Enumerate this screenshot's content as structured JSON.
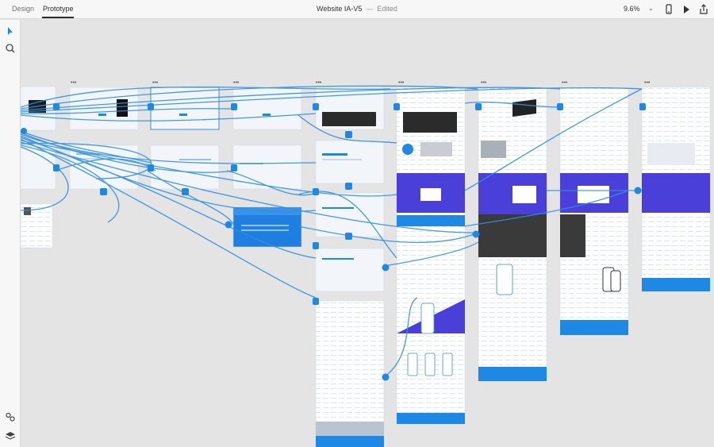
{
  "tabs": {
    "design": "Design",
    "prototype": "Prototype"
  },
  "document": {
    "title": "Website IA-V5",
    "separator": "—",
    "status": "Edited"
  },
  "zoom": {
    "value": "9.6%"
  },
  "colors": {
    "wire": "#2f8fe0",
    "accent_purple": "#4a3fd8",
    "dark": "#3a3a3a",
    "link_blue": "#1e88e5"
  },
  "icons": {
    "top_right": [
      "device-preview-icon",
      "play-icon",
      "share-icon"
    ],
    "left_toolbar": [
      "select-arrow-icon",
      "zoom-search-icon",
      "plugins-icon",
      "layers-icon"
    ]
  },
  "artboard_columns": [
    "column-1",
    "column-2",
    "column-3",
    "column-4",
    "column-5",
    "column-6",
    "column-7",
    "column-8",
    "column-9"
  ]
}
